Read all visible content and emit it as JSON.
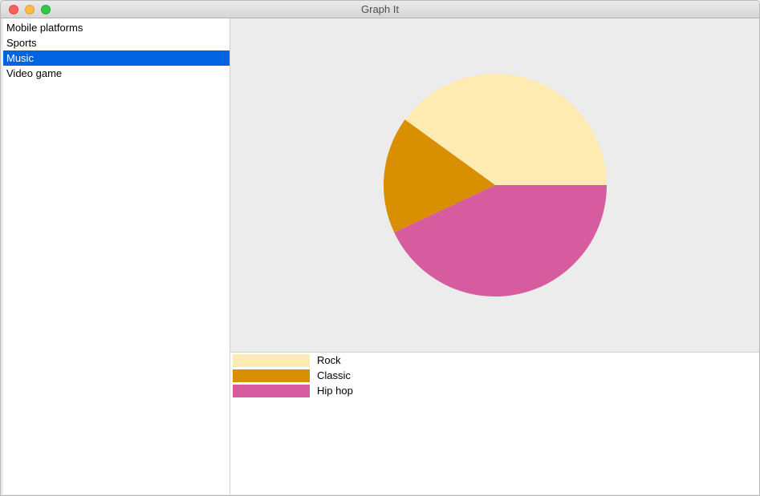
{
  "window": {
    "title": "Graph It"
  },
  "sidebar": {
    "items": [
      {
        "label": "Mobile platforms",
        "selected": false
      },
      {
        "label": "Sports",
        "selected": false
      },
      {
        "label": "Music",
        "selected": true
      },
      {
        "label": "Video game",
        "selected": false
      }
    ]
  },
  "colors": {
    "selection": "#0063e1",
    "rock": "#feebb2",
    "classic": "#d88f01",
    "hiphop": "#d65b9f"
  },
  "chart_data": {
    "type": "pie",
    "title": "",
    "slices": [
      {
        "label": "Rock",
        "value": 40,
        "color": "#feebb2"
      },
      {
        "label": "Classic",
        "value": 17,
        "color": "#d88f01"
      },
      {
        "label": "Hip hop",
        "value": 43,
        "color": "#d65b9f"
      }
    ],
    "legend": "bottom"
  }
}
